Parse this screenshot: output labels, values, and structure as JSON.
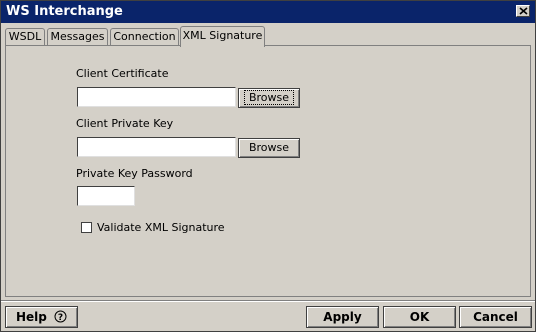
{
  "window": {
    "title": "WS Interchange"
  },
  "tabs": [
    {
      "label": "WSDL"
    },
    {
      "label": "Messages"
    },
    {
      "label": "Connection"
    },
    {
      "label": "XML Signature"
    }
  ],
  "form": {
    "client_certificate": {
      "label": "Client Certificate",
      "value": "",
      "button": "Browse"
    },
    "client_private_key": {
      "label": "Client Private Key",
      "value": "",
      "button": "Browse"
    },
    "private_key_password": {
      "label": "Private Key Password",
      "value": ""
    },
    "validate_signature": {
      "label": "Validate XML Signature",
      "checked": false
    }
  },
  "footer": {
    "help": "Help",
    "help_icon": "question-circle-icon",
    "apply": "Apply",
    "ok": "OK",
    "cancel": "Cancel"
  }
}
